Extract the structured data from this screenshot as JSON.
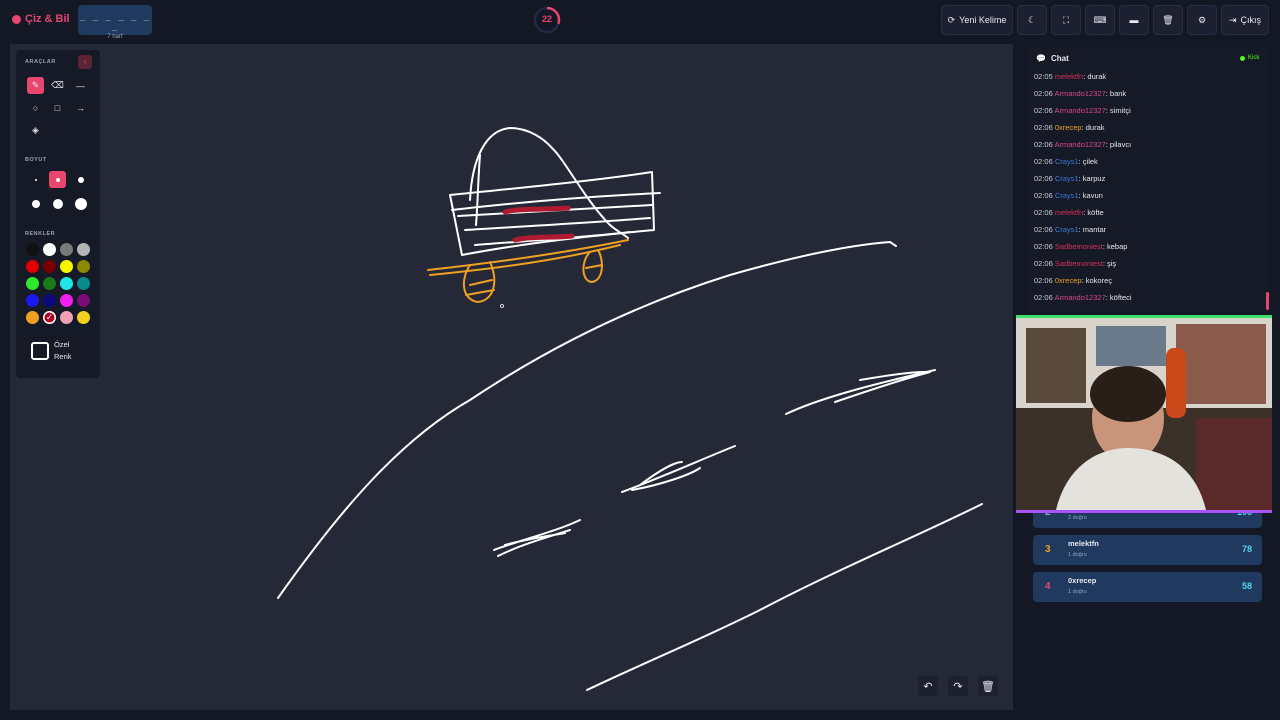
{
  "header": {
    "app_name": "Çiz & Bil",
    "word_hint": "_ _ _ _ _ _ _",
    "word_length": "7 harf",
    "timer": "22",
    "timer_progress": 0.3,
    "new_word_label": "Yeni Kelime",
    "exit_label": "Çıkış",
    "icons": [
      "moon-icon",
      "fullscreen-icon",
      "keyboard-icon",
      "archive-icon",
      "trash-icon",
      "gear-icon"
    ]
  },
  "tools": {
    "title": "ARAÇLAR",
    "size_title": "BOYUT",
    "colors_title": "RENKLER",
    "custom_color_label_1": "Özel",
    "custom_color_label_2": "Renk",
    "colors": [
      "#111111",
      "#ffffff",
      "#7a7a7a",
      "#b4b4b4",
      "#e00000",
      "#7a0000",
      "#f5f500",
      "#8a8a00",
      "#2ee82e",
      "#1a7a1a",
      "#22e6e6",
      "#0a8a8a",
      "#1a1af0",
      "#0a0a7a",
      "#f020f0",
      "#7a0a7a",
      "#f0a020",
      "#b00020",
      "#f0a0b4",
      "#f0d020"
    ]
  },
  "chat": {
    "title": "Chat",
    "platform": "Kick",
    "messages": [
      {
        "time": "02:05",
        "user": "melektfn",
        "color": "#d8305a",
        "text": ": durak"
      },
      {
        "time": "02:06",
        "user": "Armando12327",
        "color": "#d84a8a",
        "text": ": bank"
      },
      {
        "time": "02:06",
        "user": "Armando12327",
        "color": "#d84a8a",
        "text": ": simitçi"
      },
      {
        "time": "02:06",
        "user": "0xrecep",
        "color": "#f0a020",
        "text": ": durak"
      },
      {
        "time": "02:06",
        "user": "Armando12327",
        "color": "#d84a8a",
        "text": ": pilavcı"
      },
      {
        "time": "02:06",
        "user": "Crays1",
        "color": "#3a7ae0",
        "text": ": çilek"
      },
      {
        "time": "02:06",
        "user": "Crays1",
        "color": "#3a7ae0",
        "text": ": karpuz"
      },
      {
        "time": "02:06",
        "user": "Crays1",
        "color": "#3a7ae0",
        "text": ": kavun"
      },
      {
        "time": "02:06",
        "user": "melektfn",
        "color": "#d8305a",
        "text": ": köfte"
      },
      {
        "time": "02:06",
        "user": "Crays1",
        "color": "#3a7ae0",
        "text": ": mantar"
      },
      {
        "time": "02:06",
        "user": "Sadbemoniest",
        "color": "#d8305a",
        "text": ": kebap"
      },
      {
        "time": "02:06",
        "user": "Sadbemoniest",
        "color": "#d8305a",
        "text": ": şiş"
      },
      {
        "time": "02:06",
        "user": "0xrecep",
        "color": "#f0a020",
        "text": ": kokoreç"
      },
      {
        "time": "02:06",
        "user": "Armando12327",
        "color": "#d84a8a",
        "text": ": köfteci"
      }
    ]
  },
  "leaderboard": [
    {
      "rank": "2",
      "name": "",
      "sub": "2 doğru",
      "score": "105",
      "rank_color": "#8fa6c6"
    },
    {
      "rank": "3",
      "name": "melektfn",
      "sub": "1 doğru",
      "score": "78",
      "rank_color": "#f0a020"
    },
    {
      "rank": "4",
      "name": "0xrecep",
      "sub": "1 doğru",
      "score": "58",
      "rank_color": "#e8456f"
    }
  ]
}
